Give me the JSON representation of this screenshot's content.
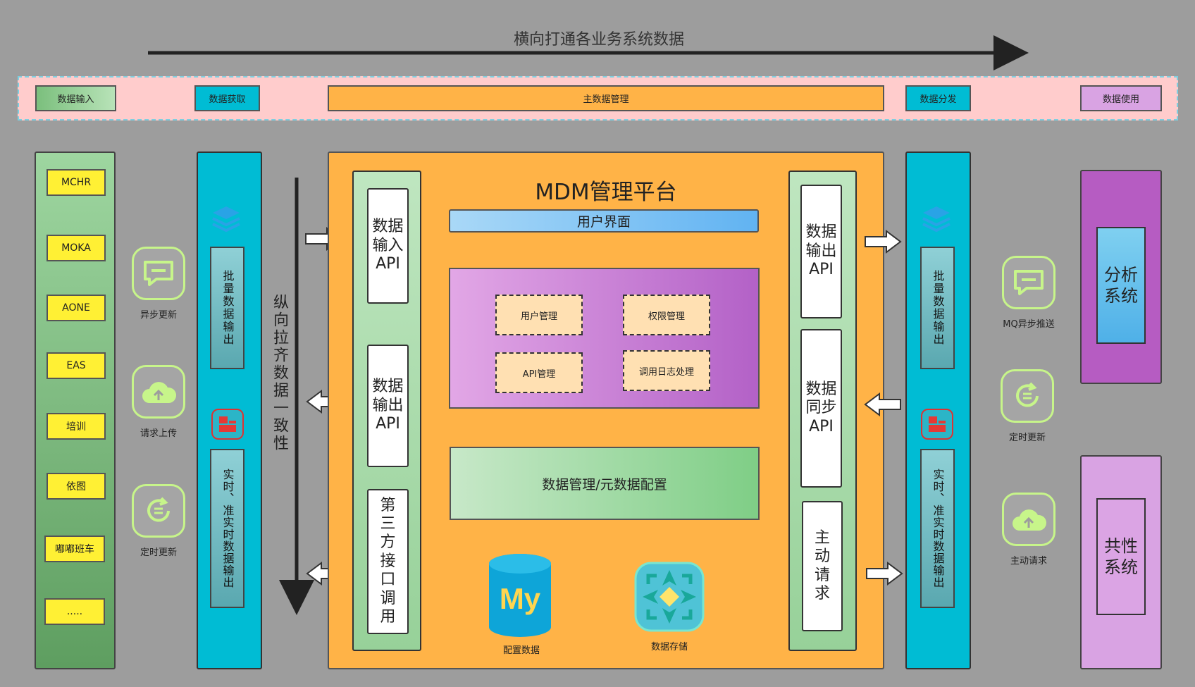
{
  "top_title": "横向打通各业务系统数据",
  "stages": {
    "input": "数据输入",
    "acquire": "数据获取",
    "master": "主数据管理",
    "distribute": "数据分发",
    "usage": "数据使用"
  },
  "sources": [
    "MCHR",
    "MOKA",
    "AONE",
    "EAS",
    "培训",
    "依图",
    "嘟嘟班车",
    "....."
  ],
  "left_icons": [
    "异步更新",
    "请求上传",
    "定时更新"
  ],
  "right_icons": [
    "MQ异步推送",
    "定时更新",
    "主动请求"
  ],
  "batch_output": "批量数据输出",
  "realtime_output": "实时、准实时数据输出",
  "consistency": "纵向拉齐数据一致性",
  "mdm": {
    "title": "MDM管理平台",
    "user_ui": "用户界面",
    "user_mgmt": "用户管理",
    "perm_mgmt": "权限管理",
    "api_mgmt": "API管理",
    "log_proc": "调用日志处理",
    "data_mgmt": "数据管理/元数据配置",
    "config_data": "配置数据",
    "data_storage": "数据存储",
    "mysql_logo": "My"
  },
  "left_api": [
    "数据输入API",
    "数据输出API",
    "第三方接口调用"
  ],
  "right_api": [
    "数据输出API",
    "数据同步API",
    "主动请求"
  ],
  "systems": [
    "分析系统",
    "共性系统"
  ],
  "colors": {
    "background": "#9d9d9d",
    "banner": "#ffcccc",
    "mdm_orange": "#ffb347",
    "blue": "#00bcd4",
    "source_yellow": "#fff034"
  }
}
